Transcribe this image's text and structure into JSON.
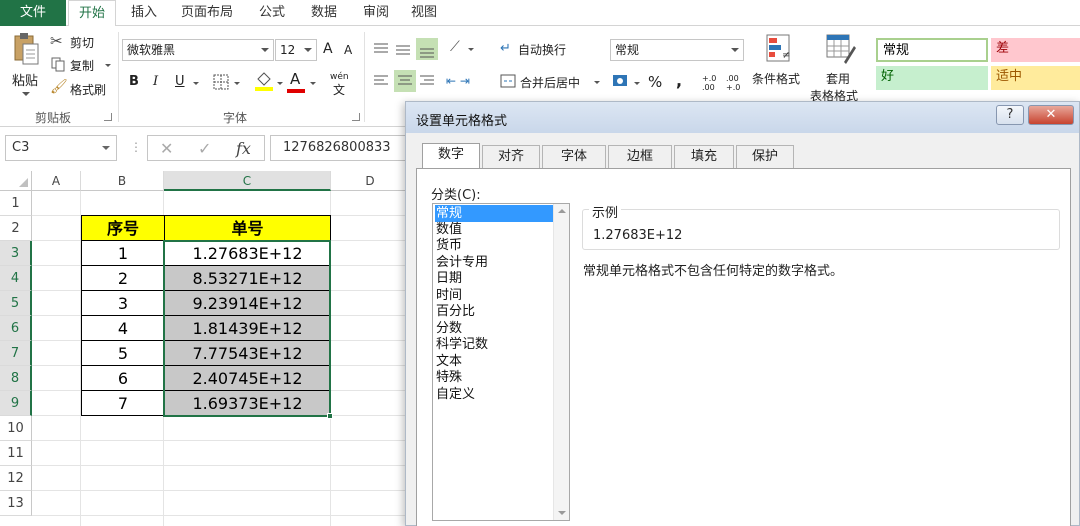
{
  "ribbon_tabs": [
    "文件",
    "开始",
    "插入",
    "页面布局",
    "公式",
    "数据",
    "审阅",
    "视图"
  ],
  "clipboard": {
    "paste": "粘贴",
    "cut": "剪切",
    "copy": "复制",
    "format_painter": "格式刷",
    "group_label": "剪贴板"
  },
  "font": {
    "name": "微软雅黑",
    "size": "12",
    "bold": "B",
    "italic": "I",
    "underline": "U",
    "grow": "A",
    "shrink": "A",
    "font_color_glyph": "A",
    "phonetic": "wén",
    "group_label": "字体"
  },
  "alignment": {
    "wrap_text": "自动换行",
    "merge_center": "合并后居中"
  },
  "number": {
    "format": "常规",
    "percent": "%",
    "comma": ",",
    "inc_decimal": "+.0 .00",
    "dec_decimal": ".00 +.0"
  },
  "styles": {
    "conditional_format": "条件格式",
    "table_format_line1": "套用",
    "table_format_line2": "表格格式",
    "cells": [
      {
        "label": "常规",
        "bg": "#ffffff",
        "fg": "#000000",
        "border": "#a9d08e"
      },
      {
        "label": "差",
        "bg": "#ffc7ce",
        "fg": "#9c0006",
        "border": "#ffc7ce"
      },
      {
        "label": "好",
        "bg": "#c6efce",
        "fg": "#006100",
        "border": "#c6efce"
      },
      {
        "label": "适中",
        "bg": "#ffeb9c",
        "fg": "#9c5700",
        "border": "#ffeb9c"
      }
    ]
  },
  "formula_bar": {
    "name_box": "C3",
    "fx": "fx",
    "cancel": "✕",
    "enter": "✓",
    "content": "1276826800833"
  },
  "sheet": {
    "columns": [
      "A",
      "B",
      "C",
      "D"
    ],
    "rows": [
      "1",
      "2",
      "3",
      "4",
      "5",
      "6",
      "7",
      "8",
      "9",
      "10",
      "11",
      "12",
      "13"
    ],
    "header": [
      "序号",
      "单号"
    ],
    "data": [
      [
        "1",
        "1.27683E+12"
      ],
      [
        "2",
        "8.53271E+12"
      ],
      [
        "3",
        "9.23914E+12"
      ],
      [
        "4",
        "1.81439E+12"
      ],
      [
        "5",
        "7.77543E+12"
      ],
      [
        "6",
        "2.40745E+12"
      ],
      [
        "7",
        "1.69373E+12"
      ]
    ],
    "header_bg": "#ffff00",
    "selected_bg": "#c8c8c8",
    "accent": "#217346"
  },
  "dialog": {
    "title": "设置单元格格式",
    "help": "?",
    "close": "✕",
    "tabs": [
      "数字",
      "对齐",
      "字体",
      "边框",
      "填充",
      "保护"
    ],
    "category_label": "分类(C):",
    "categories": [
      "常规",
      "数值",
      "货币",
      "会计专用",
      "日期",
      "时间",
      "百分比",
      "分数",
      "科学记数",
      "文本",
      "特殊",
      "自定义"
    ],
    "sample_label": "示例",
    "sample_value": "1.27683E+12",
    "description": "常规单元格格式不包含任何特定的数字格式。"
  }
}
